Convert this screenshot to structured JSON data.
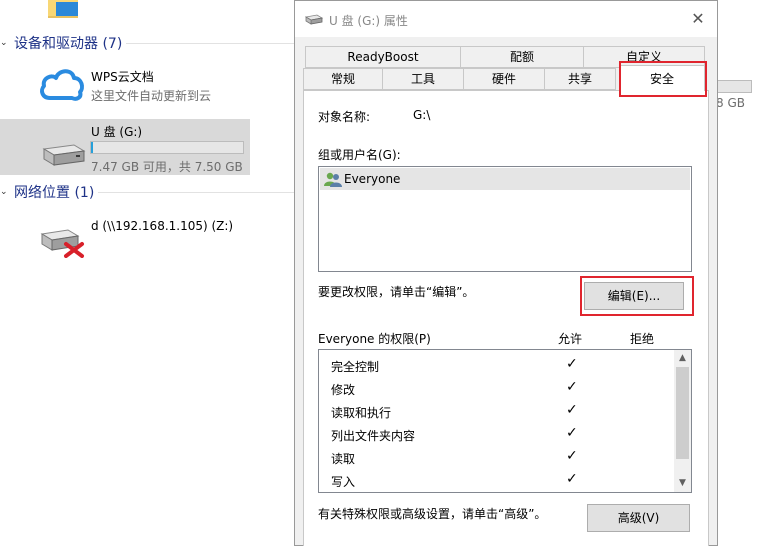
{
  "explorer": {
    "devices_section": "设备和驱动器 (7)",
    "wps": {
      "name": "WPS云文档",
      "desc": "这里文件自动更新到云"
    },
    "usb": {
      "name": "U 盘 (G:)",
      "space": "7.47 GB 可用，共 7.50 GB",
      "used_fraction": 0.004
    },
    "partial_size": "8 GB",
    "network_section": "网络位置 (1)",
    "network_drive": "d (\\\\192.168.1.105) (Z:)"
  },
  "dialog": {
    "title": "U 盘 (G:) 属性",
    "close": "✕",
    "tabs_row1": [
      "ReadyBoost",
      "配额",
      "自定义"
    ],
    "tabs_row2": [
      "常规",
      "工具",
      "硬件",
      "共享",
      "安全"
    ],
    "object_label": "对象名称:",
    "object_value": "G:\\",
    "group_label": "组或用户名(G):",
    "users": [
      "Everyone"
    ],
    "change_hint": "要更改权限，请单击“编辑”。",
    "edit_button": "编辑(E)...",
    "perm_label": "Everyone 的权限(P)",
    "allow_label": "允许",
    "deny_label": "拒绝",
    "permissions": [
      {
        "name": "完全控制",
        "allow": "✓",
        "deny": ""
      },
      {
        "name": "修改",
        "allow": "✓",
        "deny": ""
      },
      {
        "name": "读取和执行",
        "allow": "✓",
        "deny": ""
      },
      {
        "name": "列出文件夹内容",
        "allow": "✓",
        "deny": ""
      },
      {
        "name": "读取",
        "allow": "✓",
        "deny": ""
      },
      {
        "name": "写入",
        "allow": "✓",
        "deny": ""
      }
    ],
    "advanced_hint": "有关特殊权限或高级设置，请单击“高级”。",
    "advanced_button": "高级(V)"
  },
  "colors": {
    "highlight": "#e0252e",
    "accent": "#26a0da",
    "section_text": "#1e3287"
  }
}
